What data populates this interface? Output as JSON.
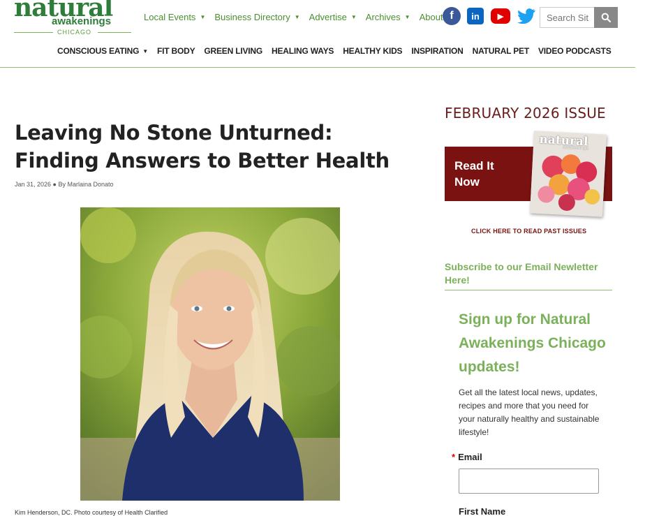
{
  "logo": {
    "word": "natural",
    "sub": "awakenings",
    "city": "CHICAGO"
  },
  "top_nav": [
    {
      "label": "Local Events"
    },
    {
      "label": "Business Directory"
    },
    {
      "label": "Advertise"
    },
    {
      "label": "Archives"
    },
    {
      "label": "About"
    }
  ],
  "social": {
    "facebook": "f",
    "linkedin": "in",
    "youtube": "▶",
    "twitter": "🐦"
  },
  "search": {
    "placeholder": "Search Sit"
  },
  "category_nav": [
    {
      "label": "CONSCIOUS EATING",
      "has_caret": true
    },
    {
      "label": "FIT BODY"
    },
    {
      "label": "GREEN LIVING"
    },
    {
      "label": "HEALING WAYS"
    },
    {
      "label": "HEALTHY KIDS"
    },
    {
      "label": "INSPIRATION"
    },
    {
      "label": "NATURAL PET"
    },
    {
      "label": "VIDEO PODCASTS"
    }
  ],
  "article": {
    "title": "Leaving No Stone Unturned: Finding Answers to Better Health",
    "meta": "Jan 31, 2026 ● By Marlaina Donato",
    "caption": "Kim Henderson, DC. Photo courtesy of Health Clarified"
  },
  "sidebar": {
    "issue_title": "FEBRUARY 2026 ISSUE",
    "read_label_1": "Read It",
    "read_label_2": "Now",
    "cover_title": "natural",
    "cover_sub": "awakenings",
    "past_issues": "CLICK HERE TO READ PAST ISSUES",
    "subscribe_heading": "Subscribe to our Email Newletter Here!",
    "signup_heading": "Sign up for Natural Awakenings Chicago updates!",
    "signup_desc": "Get all the latest local news, updates, recipes and more that you need for your naturally healthy and sustainable lifestyle!",
    "email_label": "Email",
    "required_mark": "*",
    "first_name_label": "First Name"
  },
  "colors": {
    "brand_green": "#4a8f2f",
    "accent_red": "#7a1212",
    "light_green": "#7ab15a"
  }
}
